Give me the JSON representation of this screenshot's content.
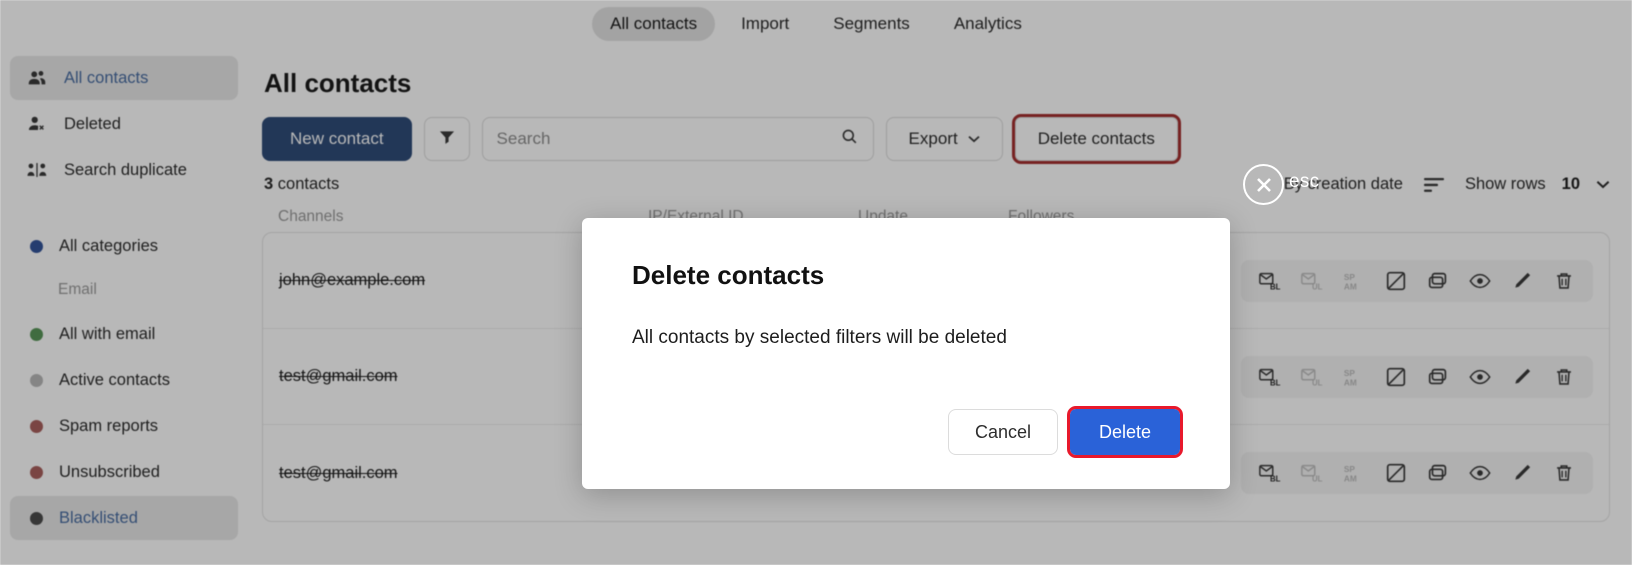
{
  "top_tabs": [
    {
      "label": "All contacts",
      "active": true
    },
    {
      "label": "Import",
      "active": false
    },
    {
      "label": "Segments",
      "active": false
    },
    {
      "label": "Analytics",
      "active": false
    }
  ],
  "sidebar": {
    "nav": [
      {
        "label": "All contacts",
        "icon": "group-icon",
        "active": true
      },
      {
        "label": "Deleted",
        "icon": "user-remove-icon",
        "active": false
      },
      {
        "label": "Search duplicate",
        "icon": "duplicate-users-icon",
        "active": false
      }
    ],
    "group_label": "Email",
    "categories": [
      {
        "label": "All categories",
        "color": "#1a56d6",
        "active": false
      },
      {
        "label": "All with email",
        "color": "#35a535",
        "active": false
      },
      {
        "label": "Active contacts",
        "color": "#b9b9b9",
        "active": false
      },
      {
        "label": "Spam reports",
        "color": "#d9534f",
        "active": false
      },
      {
        "label": "Unsubscribed",
        "color": "#d9534f",
        "active": false
      },
      {
        "label": "Blacklisted",
        "color": "#4d4d4d",
        "active": true
      }
    ]
  },
  "main": {
    "page_title": "All contacts",
    "new_contact_label": "New contact",
    "filter_icon": "funnel-icon",
    "search": {
      "value": "",
      "placeholder": "Search",
      "icon": "search-icon"
    },
    "export_label": "Export",
    "delete_contacts_label": "Delete contacts",
    "delete_contacts_highlight_color": "#f21b1b",
    "count_number": "3",
    "count_word": "contacts",
    "sort_label": "By creation date",
    "sort_icon": "sort-descending-icon",
    "show_rows_label": "Show rows",
    "show_rows_value": "10"
  },
  "table": {
    "headers": [
      "Channels",
      "IP/External ID",
      "Update",
      "Followers"
    ],
    "rows": [
      {
        "email": "john@example.com"
      },
      {
        "email": "test@gmail.com"
      },
      {
        "email": "test@gmail.com"
      }
    ],
    "row_action_icons": [
      "mail-blacklist-icon",
      "mail-unsubscribe-icon",
      "spam-icon",
      "checkbox-crossed-icon",
      "duplicate-icon",
      "eye-icon",
      "pencil-icon",
      "trash-icon"
    ]
  },
  "overlay": {
    "close_icon": "close-icon",
    "esc_label": "esc"
  },
  "modal": {
    "title": "Delete contacts",
    "body": "All contacts by selected filters will be deleted",
    "cancel_label": "Cancel",
    "delete_label": "Delete",
    "delete_accent_color": "#2a62d8",
    "delete_highlight_color": "#e8192c"
  }
}
